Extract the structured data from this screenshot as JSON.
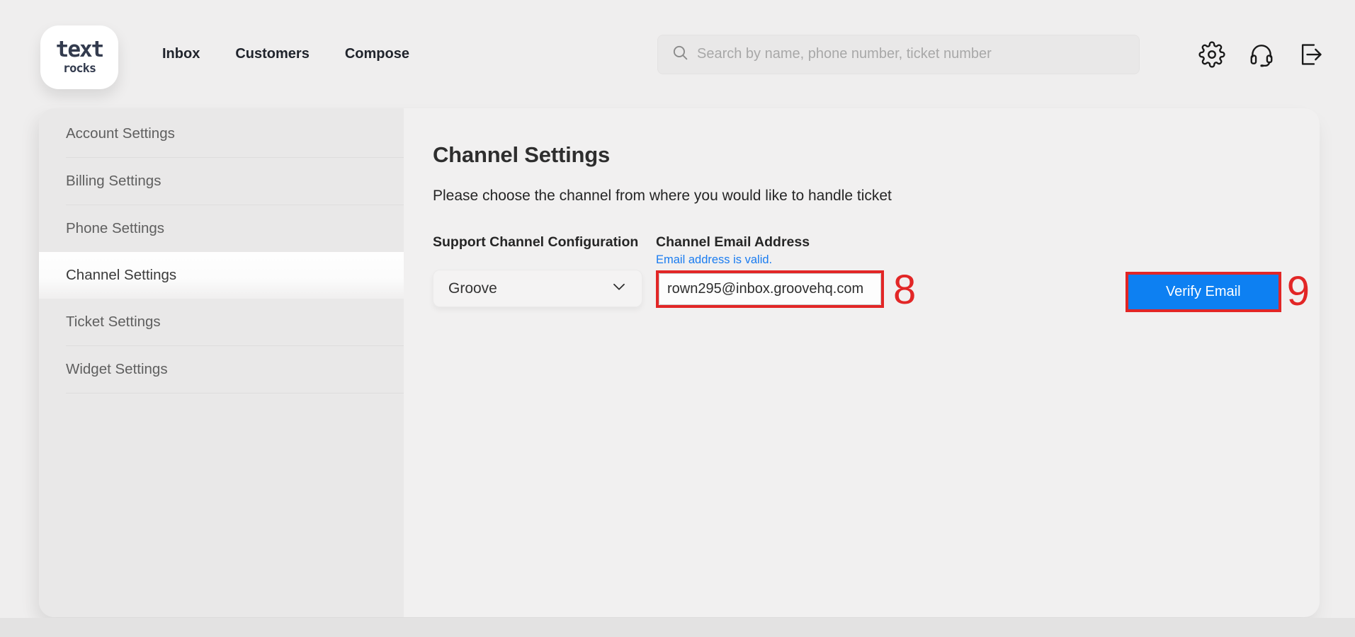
{
  "brand": {
    "line1": "text",
    "line2": "rocks"
  },
  "nav": {
    "items": [
      {
        "label": "Inbox"
      },
      {
        "label": "Customers"
      },
      {
        "label": "Compose"
      }
    ]
  },
  "search": {
    "placeholder": "Search by name, phone number, ticket number"
  },
  "header_icons": [
    {
      "name": "settings-gear-icon"
    },
    {
      "name": "support-headset-icon"
    },
    {
      "name": "logout-icon"
    }
  ],
  "sidebar": {
    "items": [
      {
        "label": "Account Settings",
        "active": false
      },
      {
        "label": "Billing Settings",
        "active": false
      },
      {
        "label": "Phone Settings",
        "active": false
      },
      {
        "label": "Channel Settings",
        "active": true
      },
      {
        "label": "Ticket Settings",
        "active": false
      },
      {
        "label": "Widget Settings",
        "active": false
      }
    ]
  },
  "main": {
    "title": "Channel Settings",
    "subtitle": "Please choose the channel from where you would like to handle ticket",
    "support_channel": {
      "label": "Support Channel Configuration",
      "selected_value": "Groove"
    },
    "email": {
      "label": "Channel Email Address",
      "status_note": "Email address is valid.",
      "value": "rown295@inbox.groovehq.com",
      "annotation": "8"
    },
    "verify": {
      "button_label": "Verify Email",
      "annotation": "9"
    }
  },
  "colors": {
    "accent_blue": "#0d80f2",
    "annotation_red": "#e22626",
    "link_blue": "#1a7cf0",
    "sidebar_bg": "#e9e8e8",
    "card_bg": "#f1f0f0"
  }
}
